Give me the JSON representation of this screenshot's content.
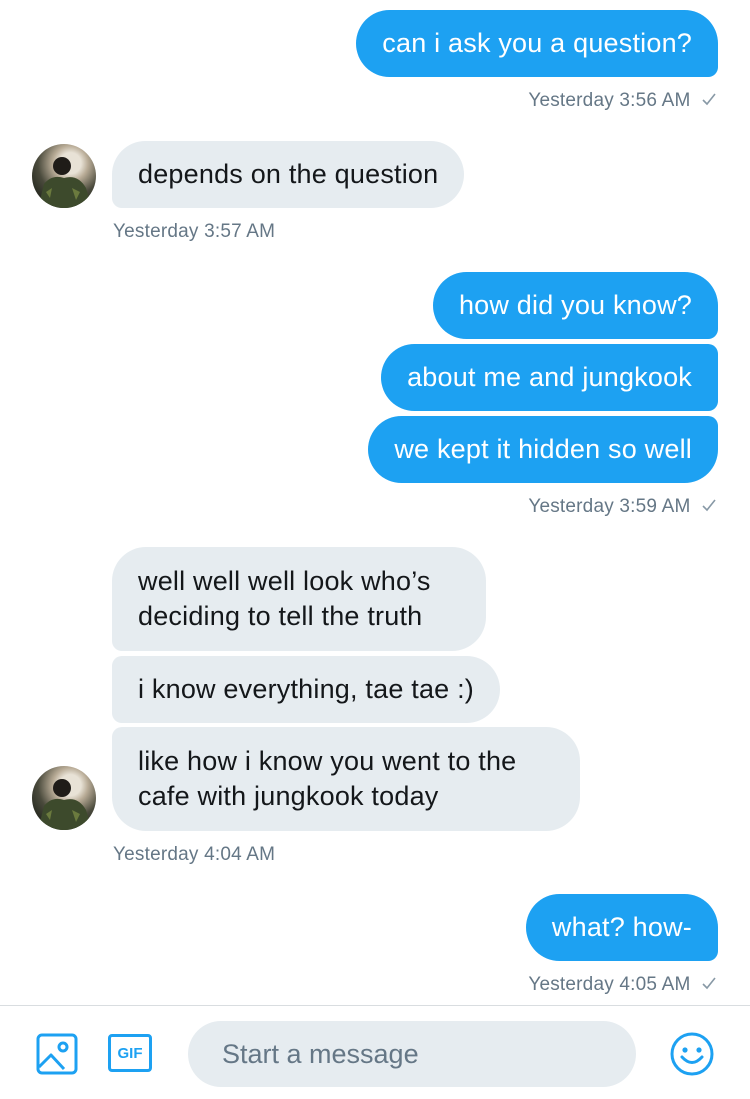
{
  "conversation": {
    "messages": [
      {
        "text": "can i ask you a question?"
      },
      {
        "text": "depends on the question"
      },
      {
        "text": "how did you know?"
      },
      {
        "text": "about me and jungkook"
      },
      {
        "text": "we kept it hidden so well"
      },
      {
        "text": "well well well look who’s deciding to tell the truth"
      },
      {
        "text": "i know everything, tae tae :)"
      },
      {
        "text": "like how i know you went to the cafe with jungkook today"
      },
      {
        "text": "what? how-"
      }
    ],
    "timestamps": [
      "Yesterday 3:56 AM",
      "Yesterday 3:57 AM",
      "Yesterday 3:59 AM",
      "Yesterday 4:04 AM",
      "Yesterday 4:05 AM"
    ]
  },
  "composer": {
    "placeholder": "Start a message",
    "gif_label": "GIF"
  },
  "icons": {
    "image": "image-icon",
    "gif": "gif-icon",
    "emoji": "emoji-icon",
    "read_receipt": "checkmark-icon"
  },
  "colors": {
    "sent_bubble": "#1da1f2",
    "received_bubble": "#e6ecf0",
    "meta_text": "#657786",
    "accent": "#1da1f2"
  }
}
